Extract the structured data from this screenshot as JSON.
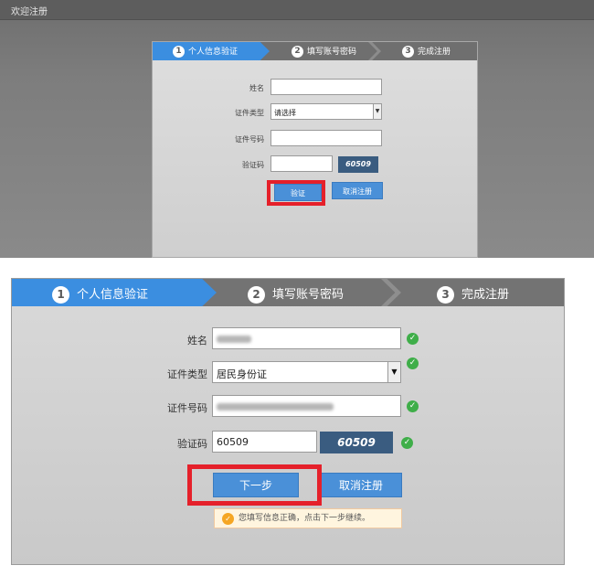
{
  "shot1": {
    "topbar_title": "欢迎注册",
    "steps": [
      {
        "num": "1",
        "label": "个人信息验证"
      },
      {
        "num": "2",
        "label": "填写账号密码"
      },
      {
        "num": "3",
        "label": "完成注册"
      }
    ],
    "form": {
      "name_label": "姓名",
      "idtype_label": "证件类型",
      "idtype_value": "请选择",
      "idnum_label": "证件号码",
      "captcha_label": "验证码",
      "captcha_image_text": "60509"
    },
    "verify_button": "验证",
    "cancel_button": "取消注册"
  },
  "shot2": {
    "steps": [
      {
        "num": "1",
        "label": "个人信息验证"
      },
      {
        "num": "2",
        "label": "填写账号密码"
      },
      {
        "num": "3",
        "label": "完成注册"
      }
    ],
    "form": {
      "name_label": "姓名",
      "idtype_label": "证件类型",
      "idtype_value": "居民身份证",
      "idnum_label": "证件号码",
      "captcha_label": "验证码",
      "captcha_value": "60509",
      "captcha_image_text": "60509"
    },
    "next_button": "下一步",
    "cancel_button": "取消注册",
    "notice": "您填写信息正确，点击下一步继续。"
  },
  "colors": {
    "accent": "#3b8ee0",
    "button": "#4a90d8",
    "highlight": "#e5202a",
    "success": "#3fae49",
    "captcha_bg": "#3a5c80"
  }
}
